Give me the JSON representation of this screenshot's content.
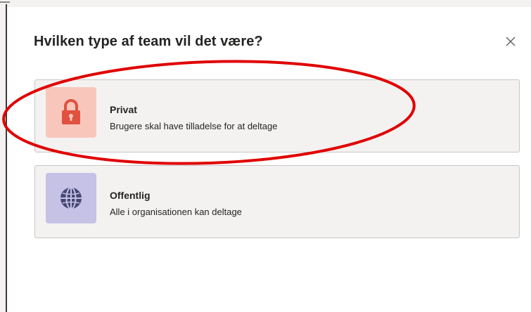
{
  "dialog": {
    "title": "Hvilken type af team vil det være?",
    "close_icon": "close-icon"
  },
  "options": [
    {
      "title": "Privat",
      "description": "Brugere skal have tilladelse for at deltage",
      "icon": "lock-icon",
      "icon_bg_color": "#f9c6bc",
      "icon_color": "#e0523f"
    },
    {
      "title": "Offentlig",
      "description": "Alle i organisationen kan deltage",
      "icon": "globe-icon",
      "icon_bg_color": "#c5c2e6",
      "icon_color": "#464775"
    }
  ],
  "annotation": {
    "shape": "ellipse",
    "color": "#e00000",
    "target": "Privat"
  }
}
